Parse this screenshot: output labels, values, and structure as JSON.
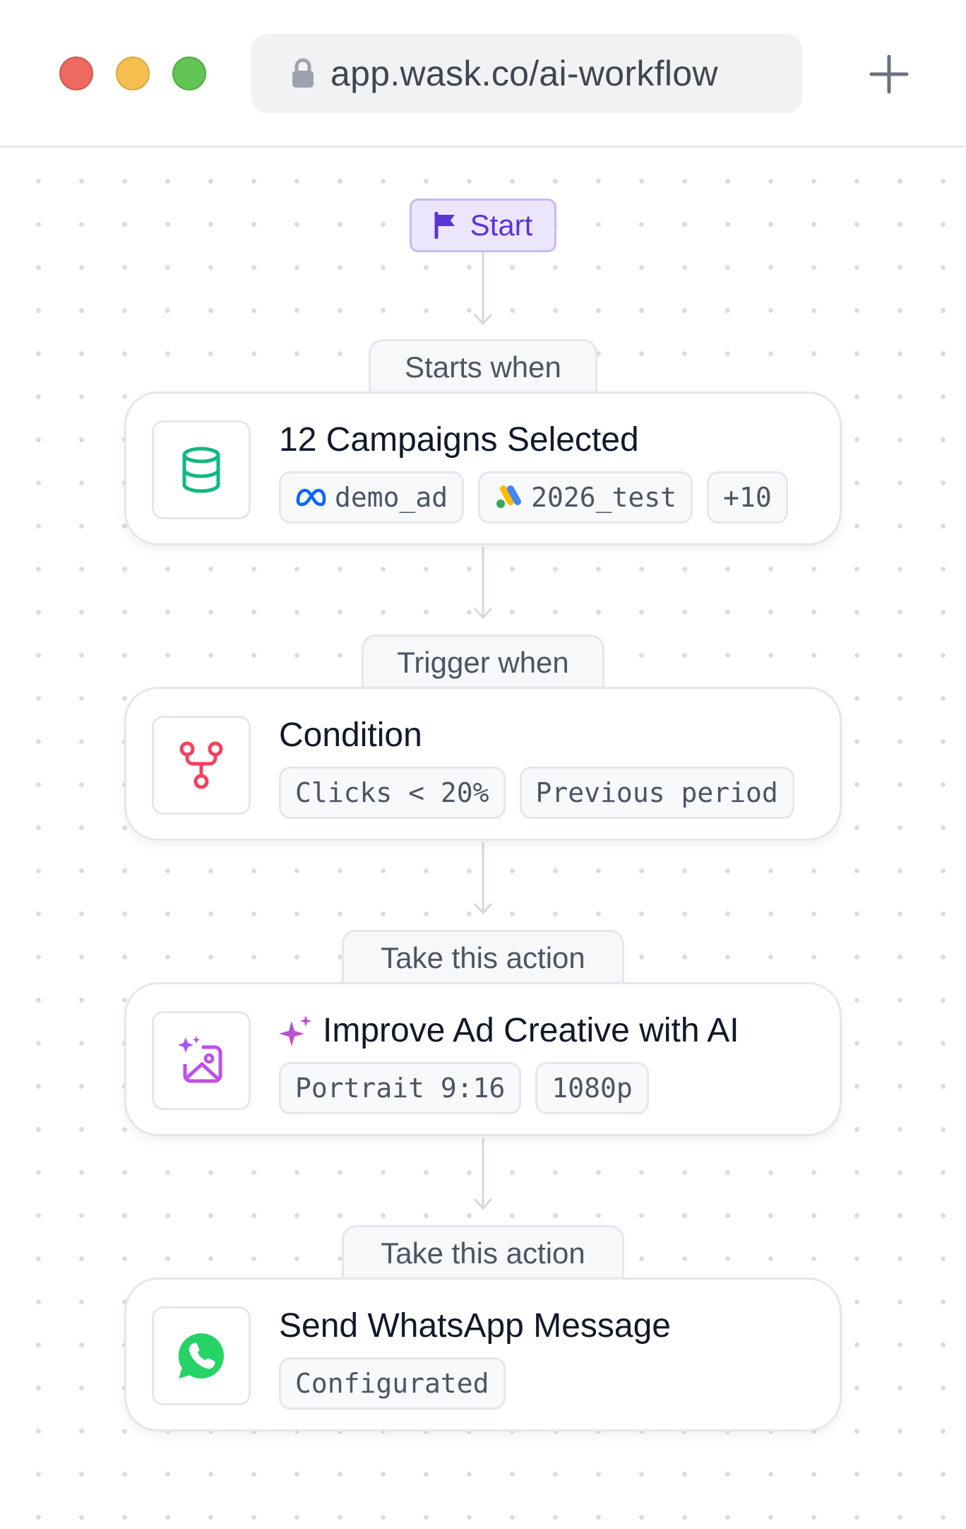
{
  "browser": {
    "url": "app.wask.co/ai-workflow",
    "icons": {
      "lock": "lock-icon",
      "new_tab": "plus-icon"
    },
    "traffic_light_colors": [
      "#ec6a5f",
      "#f4bf4f",
      "#61c454"
    ]
  },
  "workflow": {
    "start": {
      "label": "Start",
      "icon": "flag-icon",
      "color": "#5b34d6"
    },
    "steps": [
      {
        "tab": "Starts when",
        "title": "12 Campaigns Selected",
        "icon": "database-icon",
        "icon_color": "#10b981",
        "tags": [
          {
            "icon": "meta-logo-icon",
            "label": "demo_ad"
          },
          {
            "icon": "google-ads-logo-icon",
            "label": "2026_test"
          },
          {
            "label": "+10"
          }
        ]
      },
      {
        "tab": "Trigger when",
        "title": "Condition",
        "icon": "branch-icon",
        "icon_color": "#f43f5e",
        "tags": [
          {
            "label": "Clicks < 20%"
          },
          {
            "label": "Previous period"
          }
        ]
      },
      {
        "tab": "Take this action",
        "title": "Improve Ad Creative with AI",
        "title_icon": "sparkles-icon",
        "icon": "ai-image-icon",
        "icon_color": "#c04ee8",
        "tags": [
          {
            "label": "Portrait 9:16"
          },
          {
            "label": "1080p"
          }
        ]
      },
      {
        "tab": "Take this action",
        "title": "Send WhatsApp Message",
        "icon": "whatsapp-icon",
        "icon_color": "#25d366",
        "tags": [
          {
            "label": "Configurated"
          }
        ]
      }
    ]
  }
}
